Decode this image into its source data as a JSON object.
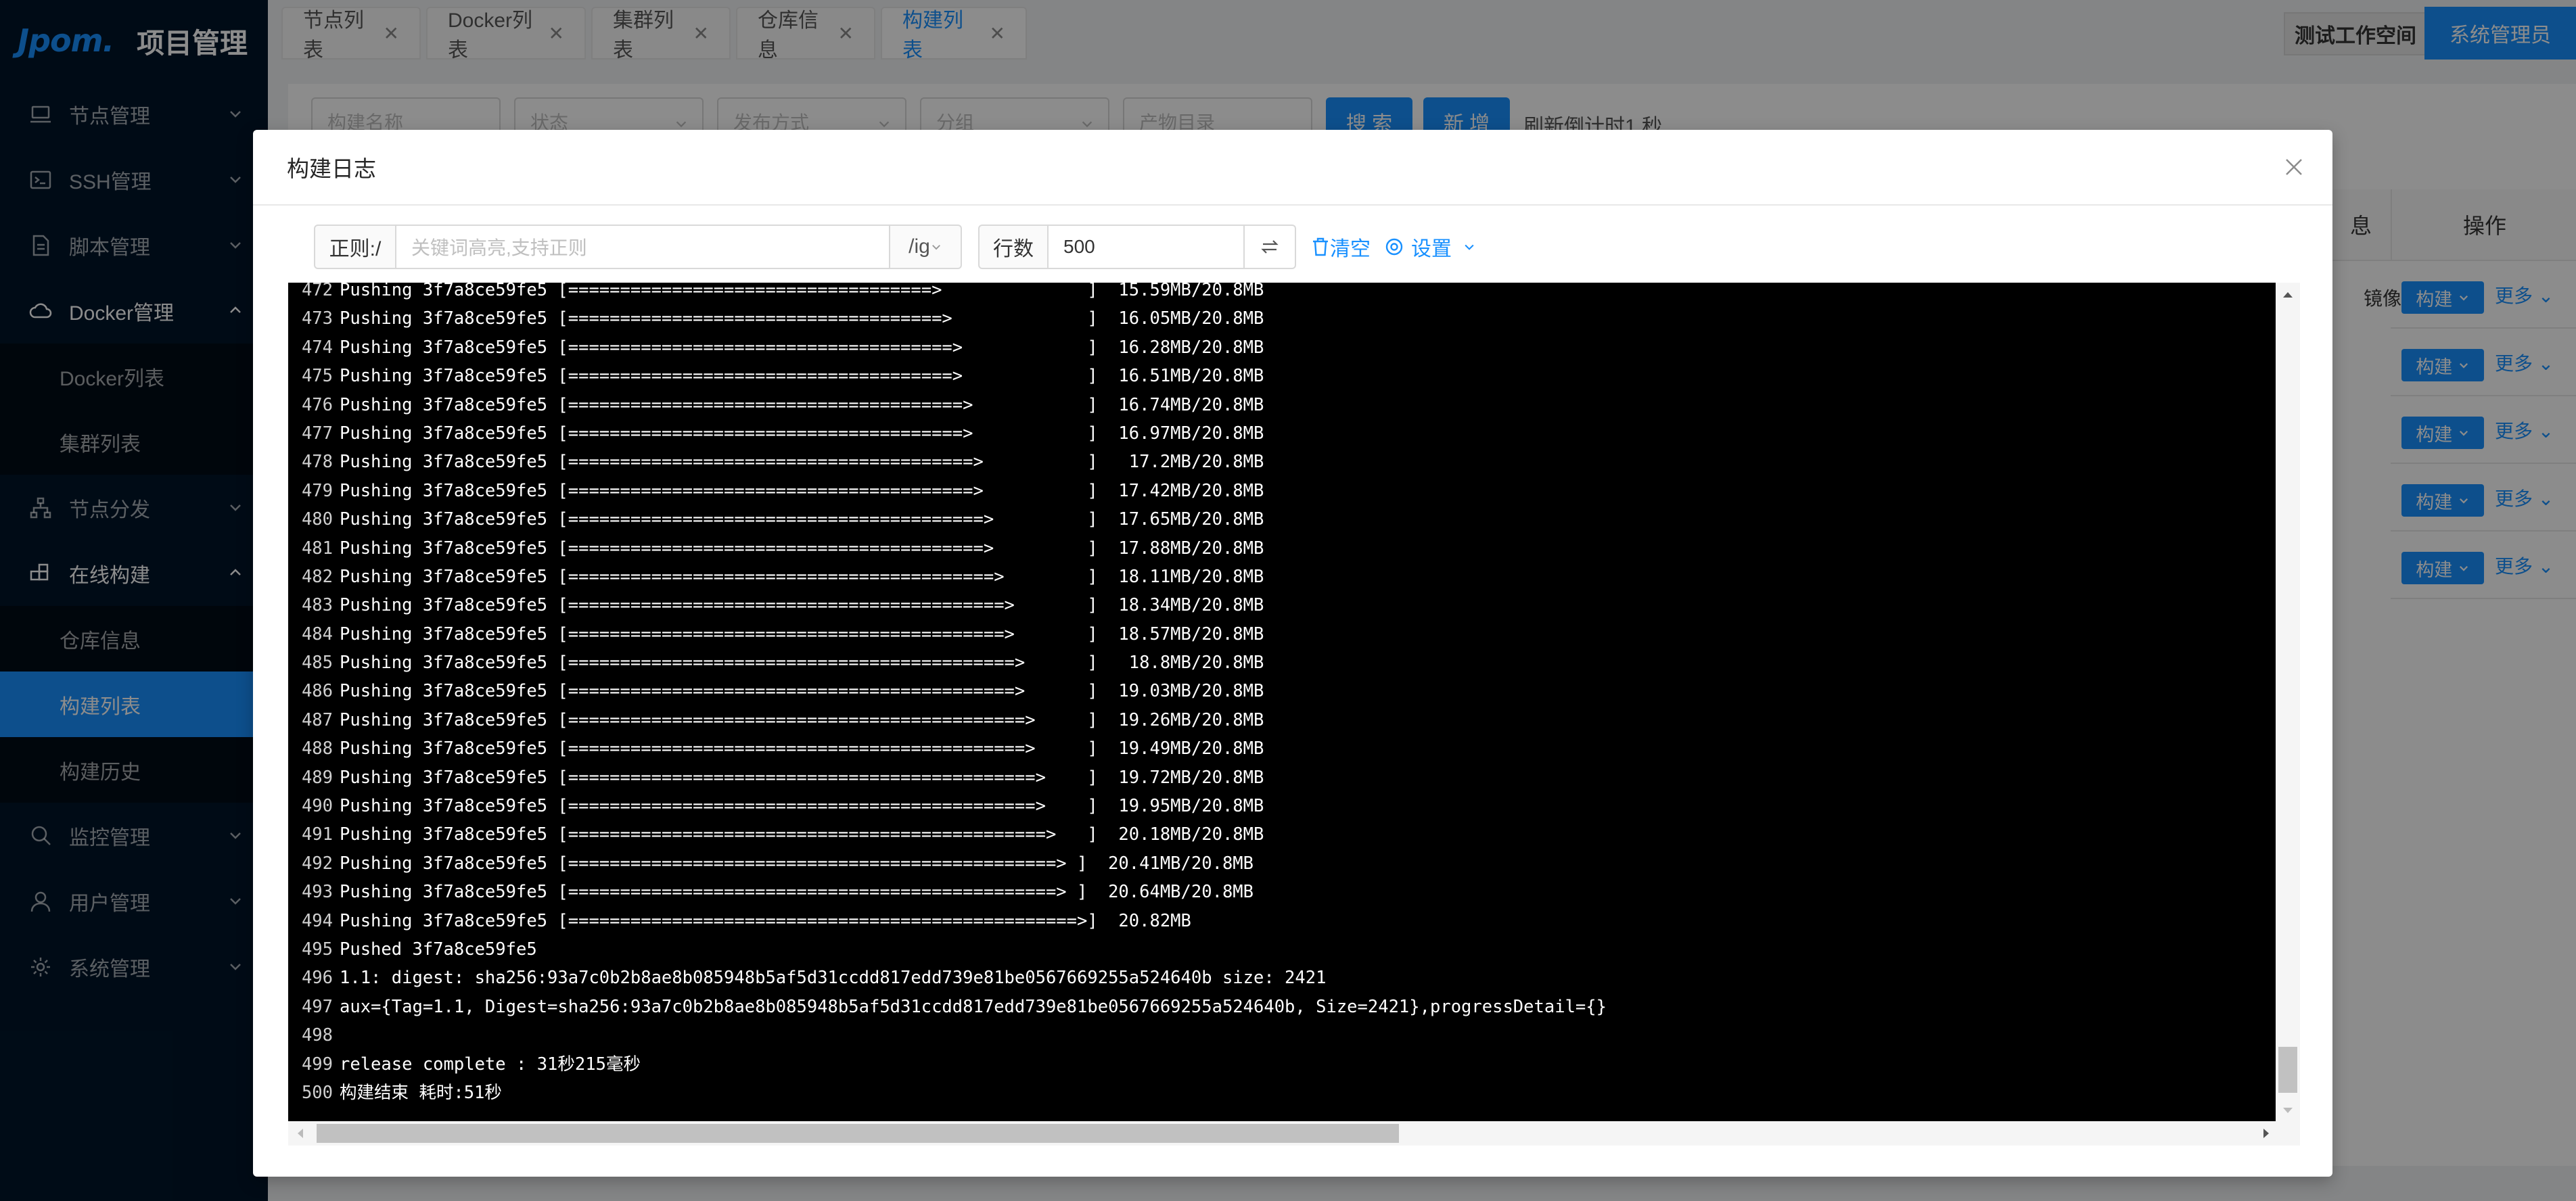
{
  "app": {
    "logo": "Jpom.",
    "title": "项目管理"
  },
  "sidebar": {
    "items": [
      {
        "label": "节点管理",
        "icon": "laptop-icon"
      },
      {
        "label": "SSH管理",
        "icon": "terminal-icon"
      },
      {
        "label": "脚本管理",
        "icon": "file-text-icon"
      },
      {
        "label": "Docker管理",
        "icon": "cloud-icon",
        "children": [
          "Docker列表",
          "集群列表"
        ]
      },
      {
        "label": "节点分发",
        "icon": "apartment-icon"
      },
      {
        "label": "在线构建",
        "icon": "build-icon",
        "children": [
          "仓库信息",
          "构建列表",
          "构建历史"
        ]
      },
      {
        "label": "监控管理",
        "icon": "monitor-icon"
      },
      {
        "label": "用户管理",
        "icon": "user-icon"
      },
      {
        "label": "系统管理",
        "icon": "setting-icon"
      }
    ],
    "active_child": "构建列表"
  },
  "tabs": [
    "节点列表",
    "Docker列表",
    "集群列表",
    "仓库信息",
    "构建列表"
  ],
  "active_tab": "构建列表",
  "workspace": "测试工作空间",
  "user": "系统管理员",
  "page": {
    "filters": {
      "name_placeholder": "构建名称",
      "status_placeholder": "状态",
      "release_placeholder": "发布方式",
      "group_placeholder": "分组",
      "product_placeholder": "产物目录"
    },
    "search_label": "搜 索",
    "new_label": "新 增",
    "countdown": "刷新倒计时1 秒",
    "table_headers": {
      "info": "息",
      "actions": "操作"
    },
    "row_extra": "镜像",
    "build_btn": "构建",
    "more_btn": "更多"
  },
  "modal": {
    "title": "构建日志",
    "regex_label": "正则:/",
    "regex_placeholder": "关键词高亮,支持正则",
    "regex_flags": "/ig",
    "rows_label": "行数",
    "rows_value": "500",
    "clear_label": "清空",
    "settings_label": "设置"
  },
  "log": {
    "lines": [
      {
        "n": "472",
        "t": "Pushing 3f7a8ce59fe5 [===================================>              ]  15.59MB/20.8MB"
      },
      {
        "n": "473",
        "t": "Pushing 3f7a8ce59fe5 [====================================>             ]  16.05MB/20.8MB"
      },
      {
        "n": "474",
        "t": "Pushing 3f7a8ce59fe5 [=====================================>            ]  16.28MB/20.8MB"
      },
      {
        "n": "475",
        "t": "Pushing 3f7a8ce59fe5 [=====================================>            ]  16.51MB/20.8MB"
      },
      {
        "n": "476",
        "t": "Pushing 3f7a8ce59fe5 [======================================>           ]  16.74MB/20.8MB"
      },
      {
        "n": "477",
        "t": "Pushing 3f7a8ce59fe5 [======================================>           ]  16.97MB/20.8MB"
      },
      {
        "n": "478",
        "t": "Pushing 3f7a8ce59fe5 [=======================================>          ]   17.2MB/20.8MB"
      },
      {
        "n": "479",
        "t": "Pushing 3f7a8ce59fe5 [=======================================>          ]  17.42MB/20.8MB"
      },
      {
        "n": "480",
        "t": "Pushing 3f7a8ce59fe5 [========================================>         ]  17.65MB/20.8MB"
      },
      {
        "n": "481",
        "t": "Pushing 3f7a8ce59fe5 [========================================>         ]  17.88MB/20.8MB"
      },
      {
        "n": "482",
        "t": "Pushing 3f7a8ce59fe5 [=========================================>        ]  18.11MB/20.8MB"
      },
      {
        "n": "483",
        "t": "Pushing 3f7a8ce59fe5 [==========================================>       ]  18.34MB/20.8MB"
      },
      {
        "n": "484",
        "t": "Pushing 3f7a8ce59fe5 [==========================================>       ]  18.57MB/20.8MB"
      },
      {
        "n": "485",
        "t": "Pushing 3f7a8ce59fe5 [===========================================>      ]   18.8MB/20.8MB"
      },
      {
        "n": "486",
        "t": "Pushing 3f7a8ce59fe5 [===========================================>      ]  19.03MB/20.8MB"
      },
      {
        "n": "487",
        "t": "Pushing 3f7a8ce59fe5 [============================================>     ]  19.26MB/20.8MB"
      },
      {
        "n": "488",
        "t": "Pushing 3f7a8ce59fe5 [============================================>     ]  19.49MB/20.8MB"
      },
      {
        "n": "489",
        "t": "Pushing 3f7a8ce59fe5 [=============================================>    ]  19.72MB/20.8MB"
      },
      {
        "n": "490",
        "t": "Pushing 3f7a8ce59fe5 [=============================================>    ]  19.95MB/20.8MB"
      },
      {
        "n": "491",
        "t": "Pushing 3f7a8ce59fe5 [==============================================>   ]  20.18MB/20.8MB"
      },
      {
        "n": "492",
        "t": "Pushing 3f7a8ce59fe5 [===============================================> ]  20.41MB/20.8MB"
      },
      {
        "n": "493",
        "t": "Pushing 3f7a8ce59fe5 [===============================================> ]  20.64MB/20.8MB"
      },
      {
        "n": "494",
        "t": "Pushing 3f7a8ce59fe5 [=================================================>]  20.82MB"
      },
      {
        "n": "495",
        "t": "Pushed 3f7a8ce59fe5"
      },
      {
        "n": "496",
        "t": "1.1: digest: sha256:93a7c0b2b8ae8b085948b5af5d31ccdd817edd739e81be0567669255a524640b size: 2421"
      },
      {
        "n": "497",
        "t": "aux={Tag=1.1, Digest=sha256:93a7c0b2b8ae8b085948b5af5d31ccdd817edd739e81be0567669255a524640b, Size=2421},progressDetail={}"
      },
      {
        "n": "498",
        "t": ""
      },
      {
        "n": "499",
        "t": "release complete : 31秒215毫秒"
      },
      {
        "n": "500",
        "t": "构建结束 耗时:51秒"
      }
    ]
  },
  "colors": {
    "primary": "#1890ff",
    "sidebar_bg": "#001529",
    "sidebar_sub_bg": "#000c17",
    "terminal_bg": "#000000"
  }
}
